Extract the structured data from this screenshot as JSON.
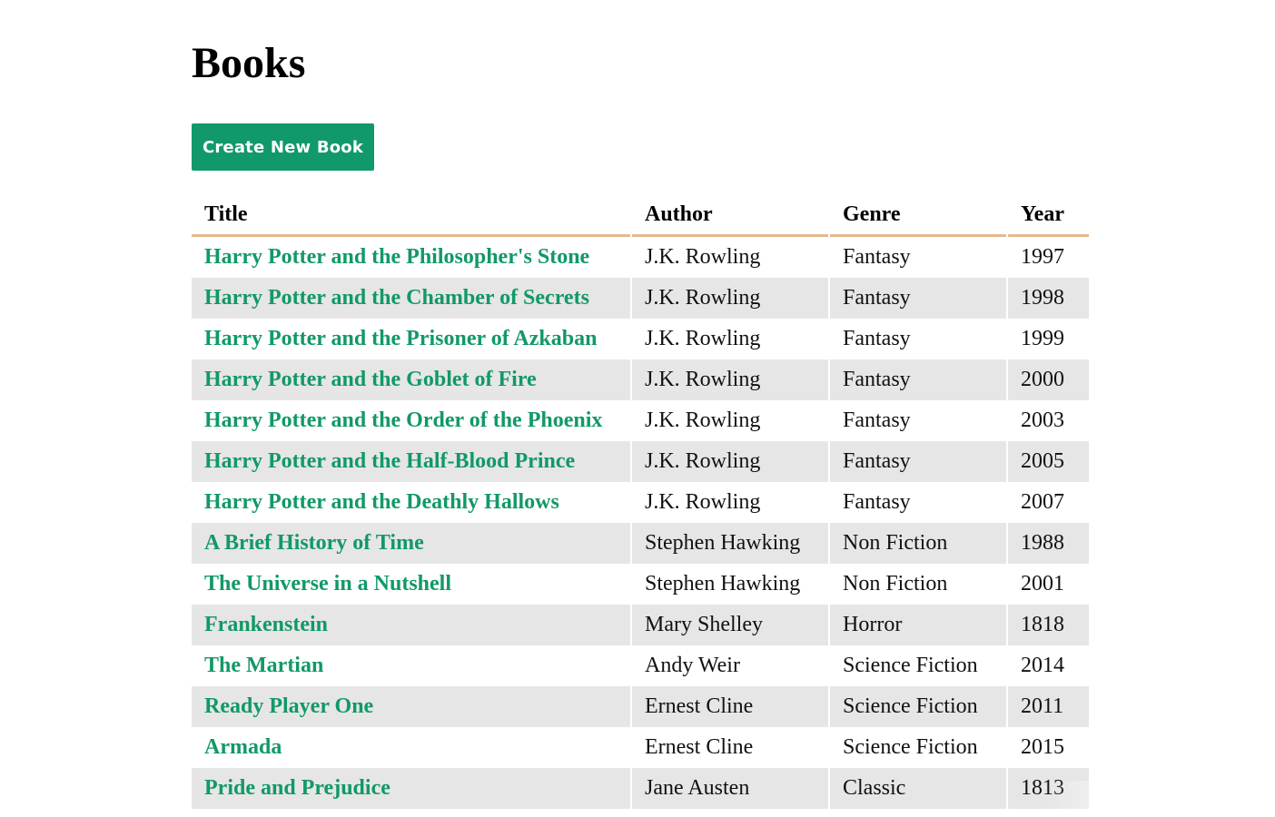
{
  "page": {
    "title": "Books",
    "create_button_label": "Create New Book"
  },
  "table": {
    "headers": {
      "title": "Title",
      "author": "Author",
      "genre": "Genre",
      "year": "Year"
    },
    "rows": [
      {
        "title": "Harry Potter and the Philosopher's Stone",
        "author": "J.K. Rowling",
        "genre": "Fantasy",
        "year": "1997"
      },
      {
        "title": "Harry Potter and the Chamber of Secrets",
        "author": "J.K. Rowling",
        "genre": "Fantasy",
        "year": "1998"
      },
      {
        "title": "Harry Potter and the Prisoner of Azkaban",
        "author": "J.K. Rowling",
        "genre": "Fantasy",
        "year": "1999"
      },
      {
        "title": "Harry Potter and the Goblet of Fire",
        "author": "J.K. Rowling",
        "genre": "Fantasy",
        "year": "2000"
      },
      {
        "title": "Harry Potter and the Order of the Phoenix",
        "author": "J.K. Rowling",
        "genre": "Fantasy",
        "year": "2003"
      },
      {
        "title": "Harry Potter and the Half-Blood Prince",
        "author": "J.K. Rowling",
        "genre": "Fantasy",
        "year": "2005"
      },
      {
        "title": "Harry Potter and the Deathly Hallows",
        "author": "J.K. Rowling",
        "genre": "Fantasy",
        "year": "2007"
      },
      {
        "title": "A Brief History of Time",
        "author": "Stephen Hawking",
        "genre": "Non Fiction",
        "year": "1988"
      },
      {
        "title": "The Universe in a Nutshell",
        "author": "Stephen Hawking",
        "genre": "Non Fiction",
        "year": "2001"
      },
      {
        "title": "Frankenstein",
        "author": "Mary Shelley",
        "genre": "Horror",
        "year": "1818"
      },
      {
        "title": "The Martian",
        "author": "Andy Weir",
        "genre": "Science Fiction",
        "year": "2014"
      },
      {
        "title": "Ready Player One",
        "author": "Ernest Cline",
        "genre": "Science Fiction",
        "year": "2011"
      },
      {
        "title": "Armada",
        "author": "Ernest Cline",
        "genre": "Science Fiction",
        "year": "2015"
      },
      {
        "title": "Pride and Prejudice",
        "author": "Jane Austen",
        "genre": "Classic",
        "year": "1813"
      }
    ]
  },
  "colors": {
    "accent": "#11996b",
    "header_rule": "#e6b98c",
    "stripe": "#e6e6e6"
  }
}
